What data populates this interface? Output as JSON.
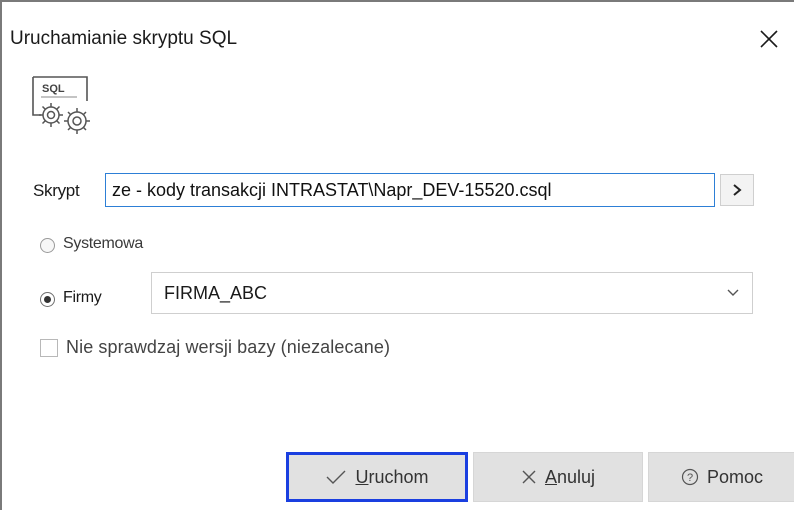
{
  "window": {
    "title": "Uruchamianie skryptu SQL",
    "icon": "sql-gears-icon"
  },
  "script": {
    "label": "Skrypt",
    "value": "ze - kody transakcji INTRASTAT\\Napr_DEV-15520.csql",
    "browse_icon": "chevron-right-icon"
  },
  "options": {
    "systemowa_label": "Systemowa",
    "systemowa_checked": false,
    "firmy_label": "Firmy",
    "firmy_checked": true,
    "firma_selected": "FIRMA_ABC",
    "no_version_check_label": "Nie sprawdzaj wersji bazy (niezalecane)",
    "no_version_check_checked": false
  },
  "buttons": {
    "run_first": "U",
    "run_rest": "ruchom",
    "cancel_first": "A",
    "cancel_rest": "nuluj",
    "help": "Pomoc"
  },
  "colors": {
    "focus_border": "#1a3fe0",
    "input_border": "#2d7fd6",
    "button_bg": "#e1e1e1"
  }
}
